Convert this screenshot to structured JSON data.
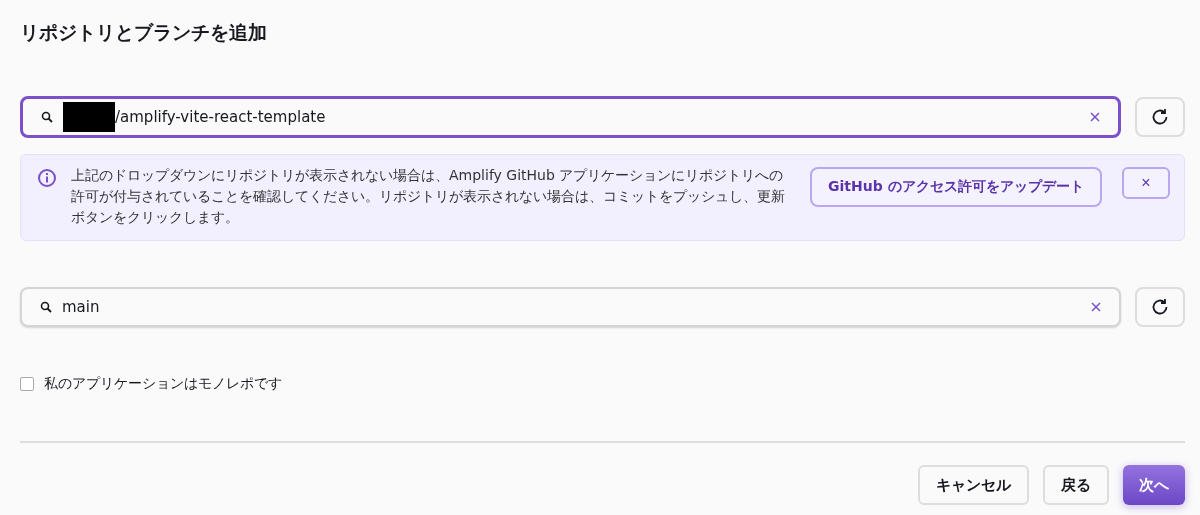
{
  "title": "リポジトリとブランチを追加",
  "repository_field": {
    "value": "/amplify-vite-react-template",
    "focused": true,
    "redacted_prefix": true
  },
  "alert": {
    "message": "上記のドロップダウンにリポジトリが表示されない場合は、Amplify GitHub アプリケーションにリポジトリへの許可が付与されていることを確認してください。リポジトリが表示されない場合は、コミットをプッシュし、更新ボタンをクリックします。",
    "action": "GitHub のアクセス許可をアップデート",
    "dismiss": "×"
  },
  "branch_field": {
    "value": "main",
    "focused": false,
    "redacted_prefix": false
  },
  "monorepo_checkbox": {
    "label": "私のアプリケーションはモノレポです",
    "checked": false
  },
  "buttons": [
    {
      "label": "キャンセル",
      "kind": "normal"
    },
    {
      "label": "戻る",
      "kind": "normal"
    },
    {
      "label": "次へ",
      "kind": "primary"
    }
  ]
}
